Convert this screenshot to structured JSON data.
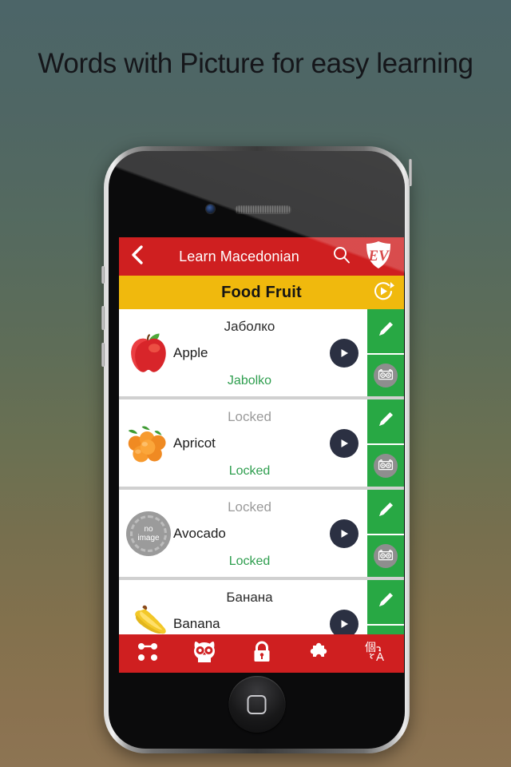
{
  "headline": "Words with Picture for easy learning",
  "colors": {
    "nav_red": "#cf1f20",
    "category_yellow": "#f0b90d",
    "action_green": "#28a844",
    "translit_green": "#2f9e4f",
    "play_navy": "#2b3042",
    "locked_gray": "#9a9a9a"
  },
  "navbar": {
    "back_icon": "chevron-left-icon",
    "title": "Learn Macedonian",
    "search_icon": "search-icon",
    "logo_icon": "ev-shield-logo",
    "logo_text": "EV"
  },
  "category_bar": {
    "title": "Food Fruit",
    "autoplay_icon": "autoplay-loop-play-icon"
  },
  "word_list": [
    {
      "image": "apple-image",
      "image_type": "photo",
      "english": "Apple",
      "native": "Јаболко",
      "native_locked": false,
      "transliteration": "Jabolko",
      "play_icon": "play-icon",
      "edit_icon": "pencil-edit-icon",
      "flashcard_icon": "owl-flashcard-icon"
    },
    {
      "image": "apricot-image",
      "image_type": "photo",
      "english": "Apricot",
      "native": "Locked",
      "native_locked": true,
      "transliteration": "Locked",
      "play_icon": "play-icon",
      "edit_icon": "pencil-edit-icon",
      "flashcard_icon": "owl-flashcard-icon"
    },
    {
      "image": "no-image-placeholder",
      "image_type": "placeholder",
      "placeholder_line1": "no",
      "placeholder_line2": "image",
      "english": "Avocado",
      "native": "Locked",
      "native_locked": true,
      "transliteration": "Locked",
      "play_icon": "play-icon",
      "edit_icon": "pencil-edit-icon",
      "flashcard_icon": "owl-flashcard-icon"
    },
    {
      "image": "banana-image",
      "image_type": "photo",
      "english": "Banana",
      "native": "Банана",
      "native_locked": false,
      "transliteration": "",
      "play_icon": "play-icon",
      "edit_icon": "pencil-edit-icon",
      "flashcard_icon": "owl-flashcard-icon"
    }
  ],
  "toolbar": [
    {
      "name": "nodes-graph-icon",
      "label": "Games"
    },
    {
      "name": "owl-icon",
      "label": "Flashcards"
    },
    {
      "name": "lock-icon",
      "label": "Unlock"
    },
    {
      "name": "puzzle-piece-icon",
      "label": "Puzzle"
    },
    {
      "name": "translate-icon",
      "label": "Translate"
    }
  ]
}
